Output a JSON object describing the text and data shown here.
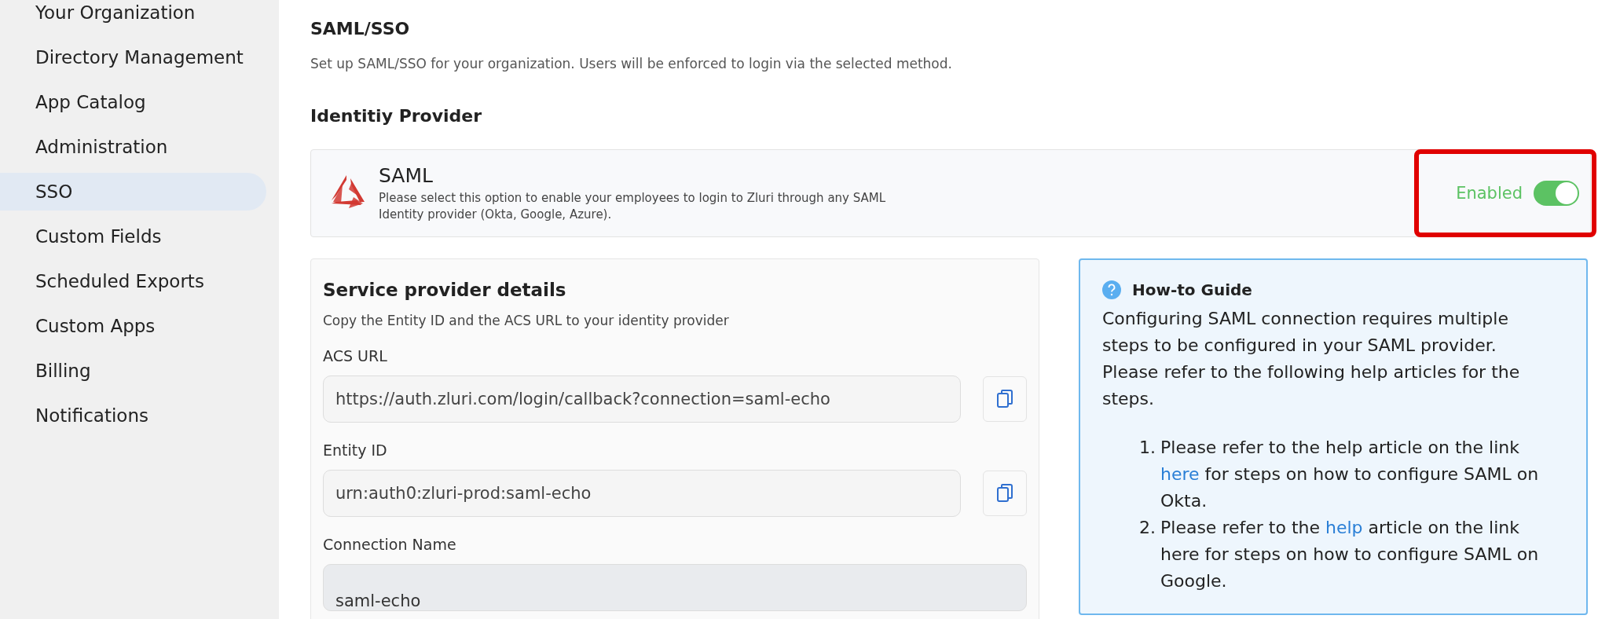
{
  "sidebar": {
    "items": [
      {
        "label": "Your Organization",
        "selected": false
      },
      {
        "label": "Directory Management",
        "selected": false
      },
      {
        "label": "App Catalog",
        "selected": false
      },
      {
        "label": "Administration",
        "selected": false
      },
      {
        "label": "SSO",
        "selected": true
      },
      {
        "label": "Custom Fields",
        "selected": false
      },
      {
        "label": "Scheduled Exports",
        "selected": false
      },
      {
        "label": "Custom Apps",
        "selected": false
      },
      {
        "label": "Billing",
        "selected": false
      },
      {
        "label": "Notifications",
        "selected": false
      }
    ]
  },
  "page": {
    "title": "SAML/SSO",
    "subtitle": "Set up SAML/SSO for your organization. Users will be enforced to login via the selected method."
  },
  "identity_provider": {
    "heading": "Identitiy Provider",
    "name": "SAML",
    "description": "Please select this option to enable your employees to login to Zluri through any SAML Identity provider (Okta, Google, Azure).",
    "status": "Enabled",
    "on": true,
    "highlighted": true
  },
  "service_provider": {
    "heading": "Service provider details",
    "subtitle": "Copy the Entity ID and the ACS URL to your identity provider",
    "fields": [
      {
        "label": "ACS URL",
        "value": "https://auth.zluri.com/login/callback?connection=saml-echo"
      },
      {
        "label": "Entity ID",
        "value": "urn:auth0:zluri-prod:saml-echo"
      }
    ],
    "connection": {
      "label": "Connection Name",
      "value": "saml-echo"
    }
  },
  "guide": {
    "title": "How-to Guide",
    "intro": "Configuring SAML connection requires multiple steps to be configured in your SAML provider. Please refer to the following help articles for the steps.",
    "steps": [
      {
        "marker": "1.",
        "parts": [
          {
            "kind": "text",
            "text": "Please refer to the help article on the link "
          },
          {
            "kind": "link",
            "text": "here"
          },
          {
            "kind": "text",
            "text": " for steps on how to configure SAML on Okta."
          }
        ]
      },
      {
        "marker": "2.",
        "parts": [
          {
            "kind": "text",
            "text": "Please refer to the "
          },
          {
            "kind": "link",
            "text": "help"
          },
          {
            "kind": "text",
            "text": " article on the link here for steps on how to configure SAML on Google."
          }
        ]
      }
    ]
  }
}
